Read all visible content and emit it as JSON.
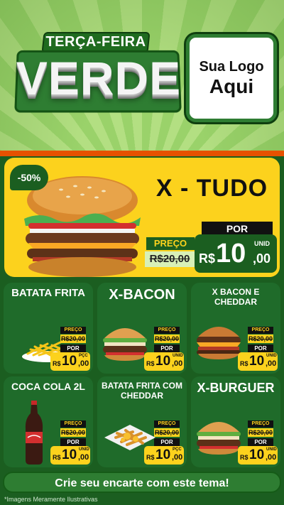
{
  "header": {
    "subtitle": "TERÇA-FEIRA",
    "title": "VERDE",
    "logo_line1": "Sua Logo",
    "logo_line2": "Aqui"
  },
  "featured": {
    "discount": "-50%",
    "name": "X - TUDO",
    "preco_label": "PREÇO",
    "old_price": "R$20,00",
    "por_label": "POR",
    "currency": "R$",
    "price_int": "10",
    "price_cents": ",00",
    "unit": "UNID"
  },
  "products": [
    {
      "name": "BATATA FRITA",
      "preco_label": "PREÇO",
      "old_price": "R$20,00",
      "por_label": "POR",
      "currency": "R$",
      "price_int": "10",
      "price_cents": ",00",
      "unit": "PÇC",
      "icon": "fries-icon"
    },
    {
      "name": "X-BACON",
      "preco_label": "PREÇO",
      "old_price": "R$20,00",
      "por_label": "POR",
      "currency": "R$",
      "price_int": "10",
      "price_cents": ",00",
      "unit": "UNID",
      "icon": "burger-icon"
    },
    {
      "name": "X BACON E CHEDDAR",
      "preco_label": "PREÇO",
      "old_price": "R$20,00",
      "por_label": "POR",
      "currency": "R$",
      "price_int": "10",
      "price_cents": ",00",
      "unit": "UNID",
      "icon": "cheddar-burger-icon"
    },
    {
      "name": "COCA COLA 2L",
      "preco_label": "PREÇO",
      "old_price": "R$20,00",
      "por_label": "POR",
      "currency": "R$",
      "price_int": "10",
      "price_cents": ",00",
      "unit": "UNID",
      "icon": "soda-bottle-icon"
    },
    {
      "name": "BATATA FRITA COM CHEDDAR",
      "preco_label": "PREÇO",
      "old_price": "R$20,00",
      "por_label": "POR",
      "currency": "R$",
      "price_int": "10",
      "price_cents": ",00",
      "unit": "PÇC",
      "icon": "cheddar-fries-icon"
    },
    {
      "name": "X-BURGUER",
      "preco_label": "PREÇO",
      "old_price": "R$20,00",
      "por_label": "POR",
      "currency": "R$",
      "price_int": "10",
      "price_cents": ",00",
      "unit": "UNID",
      "icon": "burger-icon"
    }
  ],
  "cta": "Crie seu encarte com este tema!",
  "footnote": "*Imagens Meramente Ilustrativas",
  "colors": {
    "green_dark": "#1b5e20",
    "green_card": "#1f6b2a",
    "yellow": "#fcd21d",
    "orange": "#e65100"
  }
}
